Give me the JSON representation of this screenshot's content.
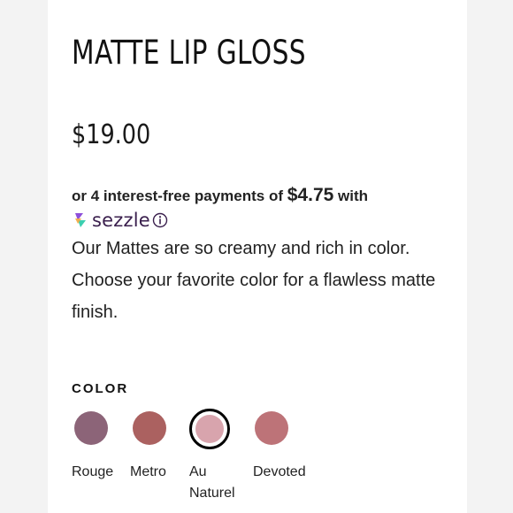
{
  "product": {
    "title": "MATTE LIP GLOSS",
    "price": "$19.00"
  },
  "payment": {
    "prefix": "or 4 interest-free payments of ",
    "amount": "$4.75",
    "suffix": " with",
    "provider": "sezzle",
    "info_icon": "info-circle-icon",
    "provider_colors": [
      "#8e4fd9",
      "#f2a940",
      "#3bcfb0"
    ]
  },
  "description": "Our Mattes are so creamy and rich in color. Choose your favorite color for a flawless matte finish.",
  "colors": {
    "heading": "COLOR",
    "selected": "Au Naturel",
    "options": [
      {
        "name": "Rouge",
        "line1": "Rouge",
        "line2": "",
        "hex": "#8c6478"
      },
      {
        "name": "Metro",
        "line1": "Metro",
        "line2": "",
        "hex": "#ab6160"
      },
      {
        "name": "Au Naturel",
        "line1": "Au",
        "line2": "Naturel",
        "hex": "#d8a4ad"
      },
      {
        "name": "Devoted",
        "line1": "Devoted",
        "line2": "",
        "hex": "#bd7378"
      }
    ]
  }
}
